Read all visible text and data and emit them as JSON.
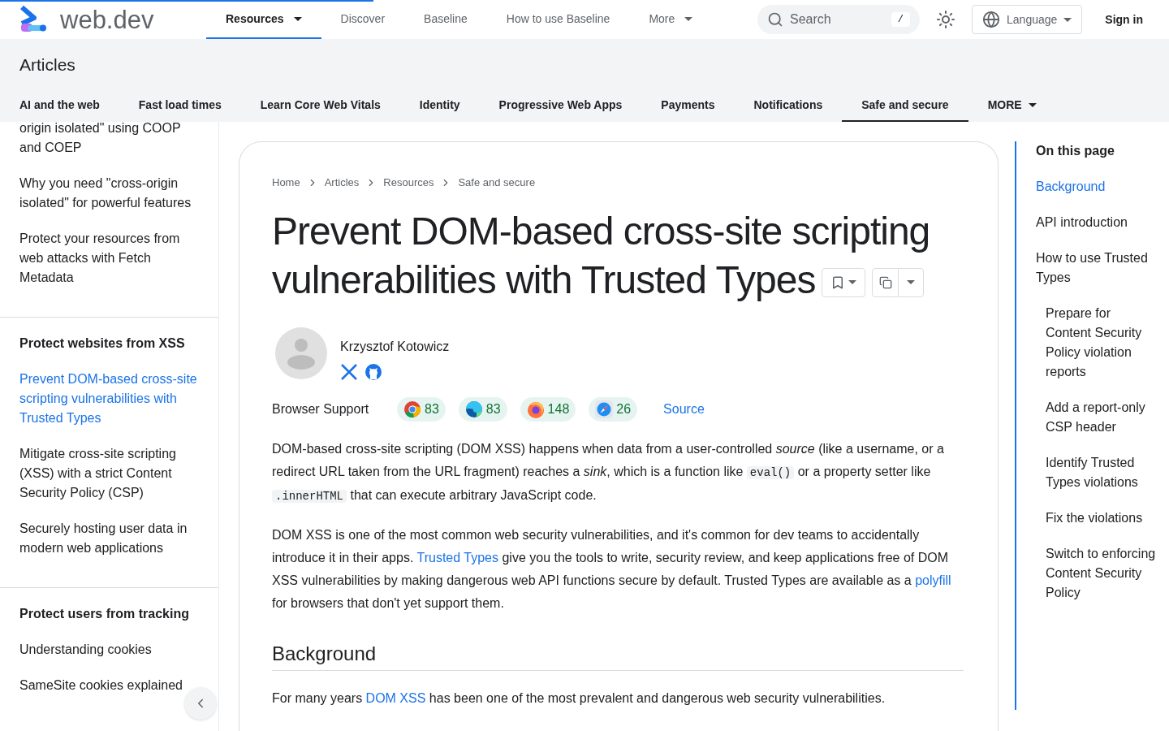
{
  "header": {
    "logo_text": "web.dev",
    "nav": [
      {
        "label": "Resources",
        "selected": true,
        "dropdown": true
      },
      {
        "label": "Discover",
        "selected": false,
        "dropdown": false
      },
      {
        "label": "Baseline",
        "selected": false,
        "dropdown": false
      },
      {
        "label": "How to use Baseline",
        "selected": false,
        "dropdown": false
      },
      {
        "label": "More",
        "selected": false,
        "dropdown": true
      }
    ],
    "search": {
      "placeholder": "Search",
      "shortcut": "/"
    },
    "language": "Language",
    "sign_in": "Sign in"
  },
  "subheader": {
    "title": "Articles",
    "tabs": [
      {
        "label": "AI and the web",
        "selected": false,
        "dropdown": false
      },
      {
        "label": "Fast load times",
        "selected": false,
        "dropdown": false
      },
      {
        "label": "Learn Core Web Vitals",
        "selected": false,
        "dropdown": false
      },
      {
        "label": "Identity",
        "selected": false,
        "dropdown": false
      },
      {
        "label": "Progressive Web Apps",
        "selected": false,
        "dropdown": false
      },
      {
        "label": "Payments",
        "selected": false,
        "dropdown": false
      },
      {
        "label": "Notifications",
        "selected": false,
        "dropdown": false
      },
      {
        "label": "Safe and secure",
        "selected": true,
        "dropdown": false
      },
      {
        "label": "MORE",
        "selected": false,
        "dropdown": true
      }
    ]
  },
  "sidebar": {
    "sections": [
      {
        "items": [
          {
            "label": "origin isolated\" using COOP and COEP",
            "selected": false
          },
          {
            "label": "Why you need \"cross-origin isolated\" for powerful features",
            "selected": false
          },
          {
            "label": "Protect your resources from web attacks with Fetch Metadata",
            "selected": false
          }
        ]
      },
      {
        "heading": "Protect websites from XSS",
        "items": [
          {
            "label": "Prevent DOM-based cross-site scripting vulnerabilities with Trusted Types",
            "selected": true
          },
          {
            "label": "Mitigate cross-site scripting (XSS) with a strict Content Security Policy (CSP)",
            "selected": false
          },
          {
            "label": "Securely hosting user data in modern web applications",
            "selected": false
          }
        ]
      },
      {
        "heading": "Protect users from tracking",
        "items": [
          {
            "label": "Understanding cookies",
            "selected": false
          },
          {
            "label": "SameSite cookies explained",
            "selected": false
          }
        ]
      }
    ]
  },
  "article": {
    "breadcrumbs": [
      "Home",
      "Articles",
      "Resources",
      "Safe and secure"
    ],
    "title": "Prevent DOM-based cross-site scripting vulnerabilities with Trusted Types",
    "author": {
      "name": "Krzysztof Kotowicz"
    },
    "browser_support": {
      "label": "Browser Support",
      "browsers": [
        {
          "kind": "chrome",
          "version": "83"
        },
        {
          "kind": "edge",
          "version": "83"
        },
        {
          "kind": "firefox",
          "version": "148"
        },
        {
          "kind": "safari",
          "version": "26"
        }
      ],
      "source": "Source"
    },
    "paragraphs": [
      [
        {
          "kind": "text",
          "text": "DOM-based cross-site scripting (DOM XSS) happens when data from a user-controlled *source* (like a username, or a redirect URL taken from the URL fragment) reaches a *sink*, which is a function like "
        },
        {
          "kind": "code",
          "text": "eval()"
        },
        {
          "kind": "text",
          "text": " or a property setter like "
        },
        {
          "kind": "code",
          "text": ".innerHTML"
        },
        {
          "kind": "text",
          "text": " that can execute arbitrary JavaScript code."
        }
      ],
      [
        {
          "kind": "text",
          "text": "DOM XSS is one of the most common web security vulnerabilities, and it's common for dev teams to accidentally introduce it in their apps. "
        },
        {
          "kind": "link",
          "text": "Trusted Types"
        },
        {
          "kind": "text",
          "text": " give you the tools to write, security review, and keep applications free of DOM XSS vulnerabilities by making dangerous web API functions secure by default. Trusted Types are available as a "
        },
        {
          "kind": "link",
          "text": "polyfill"
        },
        {
          "kind": "text",
          "text": " for browsers that don't yet support them."
        }
      ]
    ],
    "section_heading": "Background",
    "last_paragraph": [
      {
        "kind": "text",
        "text": "For many years "
      },
      {
        "kind": "link",
        "text": "DOM XSS"
      },
      {
        "kind": "text",
        "text": " has been one of the most prevalent and dangerous web security vulnerabilities."
      }
    ]
  },
  "toc": {
    "title": "On this page",
    "items": [
      {
        "label": "Background",
        "selected": true
      },
      {
        "label": "API introduction",
        "selected": false
      },
      {
        "label": "How to use Trusted Types",
        "selected": false,
        "children": [
          {
            "label": "Prepare for Content Security Policy violation reports",
            "selected": false
          },
          {
            "label": "Add a report-only CSP header",
            "selected": false
          },
          {
            "label": "Identify Trusted Types violations",
            "selected": false
          },
          {
            "label": "Fix the violations",
            "selected": false
          },
          {
            "label": "Switch to enforcing Content Security Policy",
            "selected": false
          }
        ]
      }
    ]
  }
}
